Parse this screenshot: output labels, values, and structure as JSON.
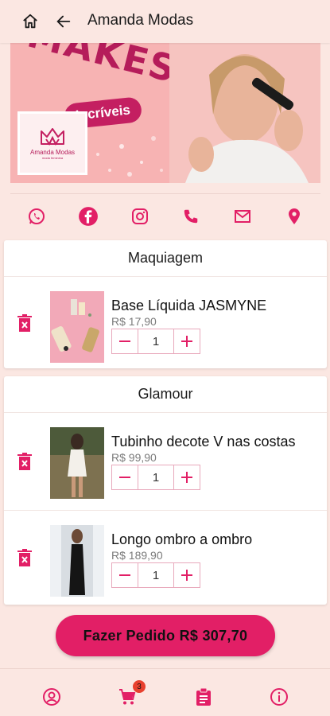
{
  "appbar": {
    "title": "Amanda Modas"
  },
  "banner": {
    "brand_text": "MAKES",
    "pill": "Incríveis",
    "logo_text": "Amanda Modas",
    "logo_sub": "moda feminina"
  },
  "categories": [
    {
      "title": "Maquiagem",
      "items": [
        {
          "name": "Base Líquida JASMYNE",
          "price": "R$ 17,90",
          "qty": "1"
        }
      ]
    },
    {
      "title": "Glamour",
      "items": [
        {
          "name": "Tubinho decote V nas costas",
          "price": "R$ 99,90",
          "qty": "1"
        },
        {
          "name": "Longo ombro a ombro",
          "price": "R$ 189,90",
          "qty": "1"
        }
      ]
    }
  ],
  "order_button": "Fazer Pedido R$ 307,70",
  "cart_badge": "3",
  "colors": {
    "accent": "#e21f66",
    "background": "#fbe7e2",
    "banner": "#f7b3b3"
  },
  "icons": {
    "appbar": [
      "home-icon",
      "back-arrow-icon"
    ],
    "social": [
      "whatsapp-icon",
      "facebook-icon",
      "instagram-icon",
      "phone-icon",
      "email-icon",
      "location-icon"
    ],
    "bottomnav": [
      "account-icon",
      "cart-icon",
      "orders-icon",
      "info-icon"
    ]
  }
}
